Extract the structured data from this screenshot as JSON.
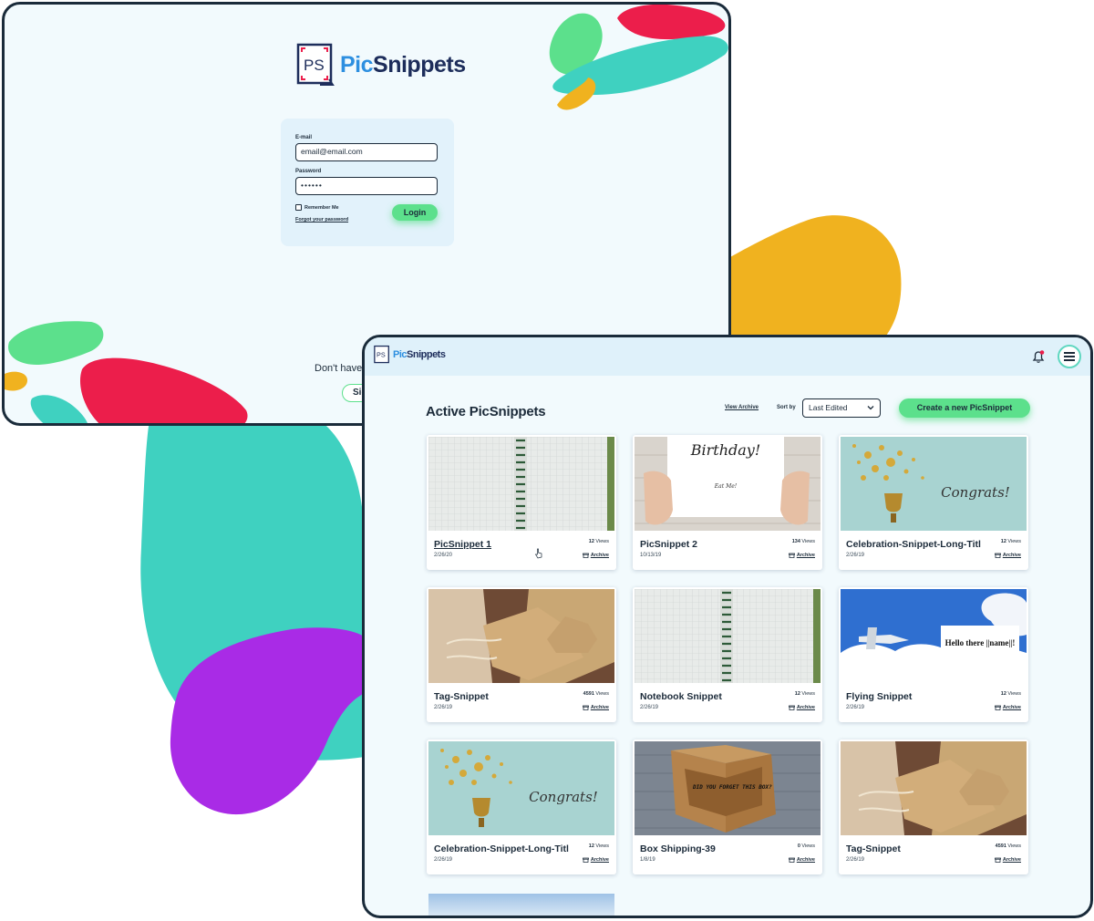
{
  "brand": {
    "pic": "Pic",
    "snippets": "Snippets"
  },
  "login": {
    "email_label": "E-mail",
    "email_value": "email@email.com",
    "password_label": "Password",
    "password_value": "••••••",
    "remember_label": "Remember Me",
    "forgot_label": "Forgot your password",
    "login_button": "Login",
    "no_account_text": "Don't have",
    "signup_button": "Sig"
  },
  "dashboard": {
    "title": "Active PicSnippets",
    "view_archive": "View Archive",
    "sort_label": "Sort by",
    "sort_value": "Last Edited",
    "create_button": "Create a new PicSnippet",
    "cards": [
      {
        "name": "PicSnippet 1",
        "date": "2/26/20",
        "views": "12",
        "views_label": "Views",
        "archive": "Archive",
        "thumb": "notebook"
      },
      {
        "name": "PicSnippet 2",
        "date": "10/13/19",
        "views": "134",
        "views_label": "Views",
        "archive": "Archive",
        "thumb": "birthday",
        "thumb_text": "Birthday!",
        "thumb_sub": "Eat Me!"
      },
      {
        "name": "Celebration-Snippet-Long-Title",
        "date": "2/26/19",
        "views": "12",
        "views_label": "Views",
        "archive": "Archive",
        "thumb": "congrats",
        "thumb_text": "Congrats!"
      },
      {
        "name": "Tag-Snippet",
        "date": "2/26/19",
        "views": "4591",
        "views_label": "Views",
        "archive": "Archive",
        "thumb": "tag"
      },
      {
        "name": "Notebook Snippet",
        "date": "2/26/19",
        "views": "12",
        "views_label": "Views",
        "archive": "Archive",
        "thumb": "notebook"
      },
      {
        "name": "Flying Snippet",
        "date": "2/26/19",
        "views": "12",
        "views_label": "Views",
        "archive": "Archive",
        "thumb": "sky",
        "thumb_text": "Hello there ||name||!"
      },
      {
        "name": "Celebration-Snippet-Long-Title",
        "date": "2/26/19",
        "views": "12",
        "views_label": "Views",
        "archive": "Archive",
        "thumb": "congrats",
        "thumb_text": "Congrats!"
      },
      {
        "name": "Box Shipping-39",
        "date": "1/8/19",
        "views": "0",
        "views_label": "Views",
        "archive": "Archive",
        "thumb": "box",
        "thumb_text": "DID YOU FORGET THIS BOX?"
      },
      {
        "name": "Tag-Snippet",
        "date": "2/26/19",
        "views": "4591",
        "views_label": "Views",
        "archive": "Archive",
        "thumb": "tag"
      }
    ]
  },
  "colors": {
    "accent_green": "#5ce08c",
    "teal": "#3fd1c0",
    "yellow": "#f0b21f",
    "purple": "#a92be6",
    "red": "#ec1e4b",
    "navy": "#1a2b3a"
  },
  "icons": {
    "bell": "bell-icon",
    "menu": "hamburger-menu-icon",
    "archive": "archive-box-icon",
    "sort": "chevron-down-icon"
  }
}
